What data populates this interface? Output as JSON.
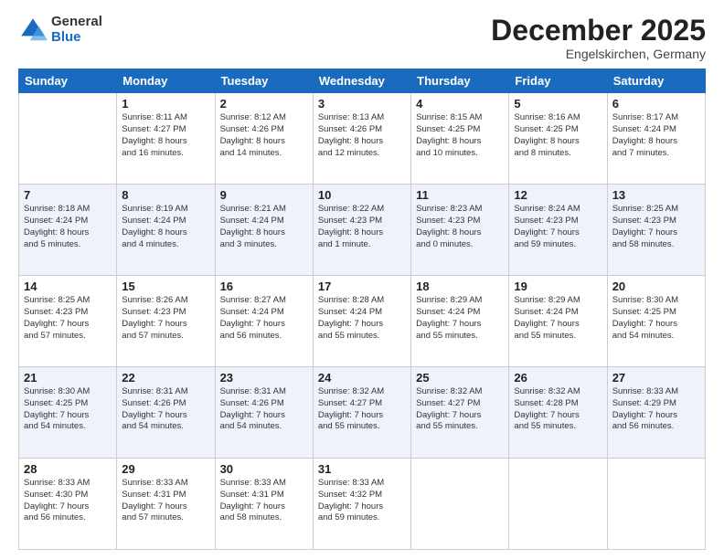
{
  "logo": {
    "general": "General",
    "blue": "Blue"
  },
  "header": {
    "month": "December 2025",
    "location": "Engelskirchen, Germany"
  },
  "weekdays": [
    "Sunday",
    "Monday",
    "Tuesday",
    "Wednesday",
    "Thursday",
    "Friday",
    "Saturday"
  ],
  "weeks": [
    [
      {
        "day": "",
        "info": ""
      },
      {
        "day": "1",
        "info": "Sunrise: 8:11 AM\nSunset: 4:27 PM\nDaylight: 8 hours\nand 16 minutes."
      },
      {
        "day": "2",
        "info": "Sunrise: 8:12 AM\nSunset: 4:26 PM\nDaylight: 8 hours\nand 14 minutes."
      },
      {
        "day": "3",
        "info": "Sunrise: 8:13 AM\nSunset: 4:26 PM\nDaylight: 8 hours\nand 12 minutes."
      },
      {
        "day": "4",
        "info": "Sunrise: 8:15 AM\nSunset: 4:25 PM\nDaylight: 8 hours\nand 10 minutes."
      },
      {
        "day": "5",
        "info": "Sunrise: 8:16 AM\nSunset: 4:25 PM\nDaylight: 8 hours\nand 8 minutes."
      },
      {
        "day": "6",
        "info": "Sunrise: 8:17 AM\nSunset: 4:24 PM\nDaylight: 8 hours\nand 7 minutes."
      }
    ],
    [
      {
        "day": "7",
        "info": "Sunrise: 8:18 AM\nSunset: 4:24 PM\nDaylight: 8 hours\nand 5 minutes."
      },
      {
        "day": "8",
        "info": "Sunrise: 8:19 AM\nSunset: 4:24 PM\nDaylight: 8 hours\nand 4 minutes."
      },
      {
        "day": "9",
        "info": "Sunrise: 8:21 AM\nSunset: 4:24 PM\nDaylight: 8 hours\nand 3 minutes."
      },
      {
        "day": "10",
        "info": "Sunrise: 8:22 AM\nSunset: 4:23 PM\nDaylight: 8 hours\nand 1 minute."
      },
      {
        "day": "11",
        "info": "Sunrise: 8:23 AM\nSunset: 4:23 PM\nDaylight: 8 hours\nand 0 minutes."
      },
      {
        "day": "12",
        "info": "Sunrise: 8:24 AM\nSunset: 4:23 PM\nDaylight: 7 hours\nand 59 minutes."
      },
      {
        "day": "13",
        "info": "Sunrise: 8:25 AM\nSunset: 4:23 PM\nDaylight: 7 hours\nand 58 minutes."
      }
    ],
    [
      {
        "day": "14",
        "info": "Sunrise: 8:25 AM\nSunset: 4:23 PM\nDaylight: 7 hours\nand 57 minutes."
      },
      {
        "day": "15",
        "info": "Sunrise: 8:26 AM\nSunset: 4:23 PM\nDaylight: 7 hours\nand 57 minutes."
      },
      {
        "day": "16",
        "info": "Sunrise: 8:27 AM\nSunset: 4:24 PM\nDaylight: 7 hours\nand 56 minutes."
      },
      {
        "day": "17",
        "info": "Sunrise: 8:28 AM\nSunset: 4:24 PM\nDaylight: 7 hours\nand 55 minutes."
      },
      {
        "day": "18",
        "info": "Sunrise: 8:29 AM\nSunset: 4:24 PM\nDaylight: 7 hours\nand 55 minutes."
      },
      {
        "day": "19",
        "info": "Sunrise: 8:29 AM\nSunset: 4:24 PM\nDaylight: 7 hours\nand 55 minutes."
      },
      {
        "day": "20",
        "info": "Sunrise: 8:30 AM\nSunset: 4:25 PM\nDaylight: 7 hours\nand 54 minutes."
      }
    ],
    [
      {
        "day": "21",
        "info": "Sunrise: 8:30 AM\nSunset: 4:25 PM\nDaylight: 7 hours\nand 54 minutes."
      },
      {
        "day": "22",
        "info": "Sunrise: 8:31 AM\nSunset: 4:26 PM\nDaylight: 7 hours\nand 54 minutes."
      },
      {
        "day": "23",
        "info": "Sunrise: 8:31 AM\nSunset: 4:26 PM\nDaylight: 7 hours\nand 54 minutes."
      },
      {
        "day": "24",
        "info": "Sunrise: 8:32 AM\nSunset: 4:27 PM\nDaylight: 7 hours\nand 55 minutes."
      },
      {
        "day": "25",
        "info": "Sunrise: 8:32 AM\nSunset: 4:27 PM\nDaylight: 7 hours\nand 55 minutes."
      },
      {
        "day": "26",
        "info": "Sunrise: 8:32 AM\nSunset: 4:28 PM\nDaylight: 7 hours\nand 55 minutes."
      },
      {
        "day": "27",
        "info": "Sunrise: 8:33 AM\nSunset: 4:29 PM\nDaylight: 7 hours\nand 56 minutes."
      }
    ],
    [
      {
        "day": "28",
        "info": "Sunrise: 8:33 AM\nSunset: 4:30 PM\nDaylight: 7 hours\nand 56 minutes."
      },
      {
        "day": "29",
        "info": "Sunrise: 8:33 AM\nSunset: 4:31 PM\nDaylight: 7 hours\nand 57 minutes."
      },
      {
        "day": "30",
        "info": "Sunrise: 8:33 AM\nSunset: 4:31 PM\nDaylight: 7 hours\nand 58 minutes."
      },
      {
        "day": "31",
        "info": "Sunrise: 8:33 AM\nSunset: 4:32 PM\nDaylight: 7 hours\nand 59 minutes."
      },
      {
        "day": "",
        "info": ""
      },
      {
        "day": "",
        "info": ""
      },
      {
        "day": "",
        "info": ""
      }
    ]
  ]
}
